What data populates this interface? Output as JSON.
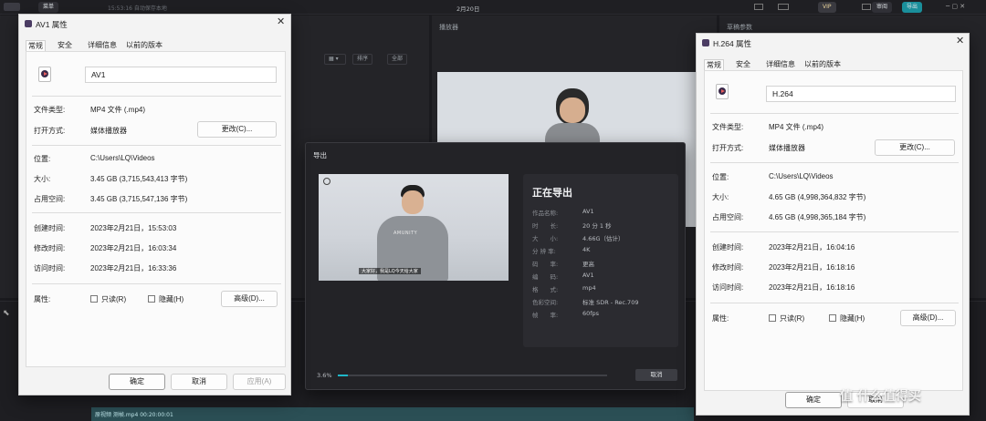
{
  "editor": {
    "menu_label": "菜单",
    "autosave_text": "15:53:16 自动保存本地",
    "project_date": "2月20日",
    "vip_badge": "VIP",
    "review_label": "审阅",
    "export_label": "导出",
    "player_panel_title": "播放器",
    "props_panel_title": "草稿参数",
    "toolbar": {
      "sort_label": "排序",
      "all_label": "全部"
    },
    "timeline_clip_label": "原视频 测帧.mp4  00:20:00:01"
  },
  "export_dialog": {
    "title": "导出",
    "heading": "正在导出",
    "subtitle_text": "大家好，我是LQ今天给大家",
    "rows": [
      {
        "label": "作品名称:",
        "value": "AV1"
      },
      {
        "label": "时　　长:",
        "value": "20 分 1 秒"
      },
      {
        "label": "大　　小:",
        "value": "4.66G（估计）"
      },
      {
        "label": "分 辨 率:",
        "value": "4K"
      },
      {
        "label": "码　　率:",
        "value": "更高"
      },
      {
        "label": "编　　码:",
        "value": "AV1"
      },
      {
        "label": "格　　式:",
        "value": "mp4"
      },
      {
        "label": "色彩空间:",
        "value": "标准 SDR - Rec.709"
      },
      {
        "label": "帧　　率:",
        "value": "60fps"
      }
    ],
    "progress_text": "3.6%",
    "progress": 0.036,
    "cancel_label": "取消"
  },
  "av1_props": {
    "title": "AV1 属性",
    "tabs": [
      "常规",
      "安全",
      "详细信息",
      "以前的版本"
    ],
    "file_name": "AV1",
    "file_type_label": "文件类型:",
    "file_type_value": "MP4 文件 (.mp4)",
    "open_with_label": "打开方式:",
    "open_with_value": "媒体播放器",
    "change_button": "更改(C)...",
    "location_label": "位置:",
    "location_value": "C:\\Users\\LQ\\Videos",
    "size_label": "大小:",
    "size_value": "3.45 GB (3,715,543,413 字节)",
    "disk_size_label": "占用空间:",
    "disk_size_value": "3.45 GB (3,715,547,136 字节)",
    "created_label": "创建时间:",
    "created_value": "2023年2月21日，15:53:03",
    "modified_label": "修改时间:",
    "modified_value": "2023年2月21日，16:03:34",
    "accessed_label": "访问时间:",
    "accessed_value": "2023年2月21日，16:33:36",
    "attributes_label": "属性:",
    "readonly_label": "只读(R)",
    "hidden_label": "隐藏(H)",
    "advanced_button": "高级(D)...",
    "ok_button": "确定",
    "cancel_button": "取消",
    "apply_button": "应用(A)"
  },
  "h264_props": {
    "title": "H.264 属性",
    "tabs": [
      "常规",
      "安全",
      "详细信息",
      "以前的版本"
    ],
    "file_name": "H.264",
    "file_type_label": "文件类型:",
    "file_type_value": "MP4 文件 (.mp4)",
    "open_with_label": "打开方式:",
    "open_with_value": "媒体播放器",
    "change_button": "更改(C)...",
    "location_label": "位置:",
    "location_value": "C:\\Users\\LQ\\Videos",
    "size_label": "大小:",
    "size_value": "4.65 GB (4,998,364,832 字节)",
    "disk_size_label": "占用空间:",
    "disk_size_value": "4.65 GB (4,998,365,184 字节)",
    "created_label": "创建时间:",
    "created_value": "2023年2月21日，16:04:16",
    "modified_label": "修改时间:",
    "modified_value": "2023年2月21日，16:18:16",
    "accessed_label": "访问时间:",
    "accessed_value": "2023年2月21日，16:18:16",
    "attributes_label": "属性:",
    "readonly_label": "只读(R)",
    "hidden_label": "隐藏(H)",
    "advanced_button": "高级(D)...",
    "ok_button": "确定",
    "cancel_button": "取消"
  },
  "watermark": "值 什么值得买",
  "colors": {
    "accent": "#1fb7c8",
    "app_bg": "#1b1b1f",
    "dialog_bg": "#f3f3f3"
  }
}
